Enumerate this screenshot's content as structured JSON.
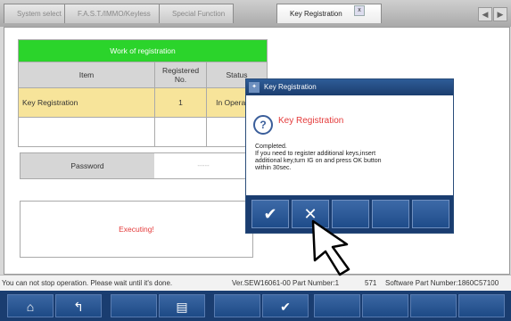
{
  "tabs": [
    {
      "label": "System select"
    },
    {
      "label": "F.A.S.T./IMMO/Keyless"
    },
    {
      "label": "Special Function"
    },
    {
      "label": "Key Registration",
      "close": "x"
    }
  ],
  "nav": {
    "prev": "◀",
    "next": "▶"
  },
  "work_table": {
    "title": "Work of registration",
    "headers": {
      "item": "Item",
      "registered": "Registered No.",
      "status": "Status"
    },
    "rows": [
      {
        "item": "Key Registration",
        "registered": "1",
        "status": "In Operation"
      }
    ]
  },
  "password": {
    "label": "Password",
    "value": "-----"
  },
  "executing_text": "Executing!",
  "dialog": {
    "title": "Key Registration",
    "heading": "Key Registration",
    "icon": "question-icon",
    "body_lines": [
      "Completed.",
      "If you need to register additional keys,insert",
      "additional key,turn IG on and press OK button",
      "within 30sec."
    ],
    "ok_icon": "check-icon",
    "cancel_icon": "x-icon"
  },
  "status_bar": {
    "message": "You can not stop operation. Please wait until it's done.",
    "version": "Ver.SEW16061-00 Part Number:1",
    "part_tail": "571",
    "software_part": "Software Part Number:1860C57100"
  },
  "bottom_bar": {
    "icons": [
      "home-icon",
      "back-icon",
      "print-icon",
      "check-icon"
    ]
  },
  "colors": {
    "header_green": "#2bd42b",
    "row_yellow": "#f7e49a",
    "dialog_blue": "#1a3d70",
    "alert_red": "#e43a3a"
  }
}
